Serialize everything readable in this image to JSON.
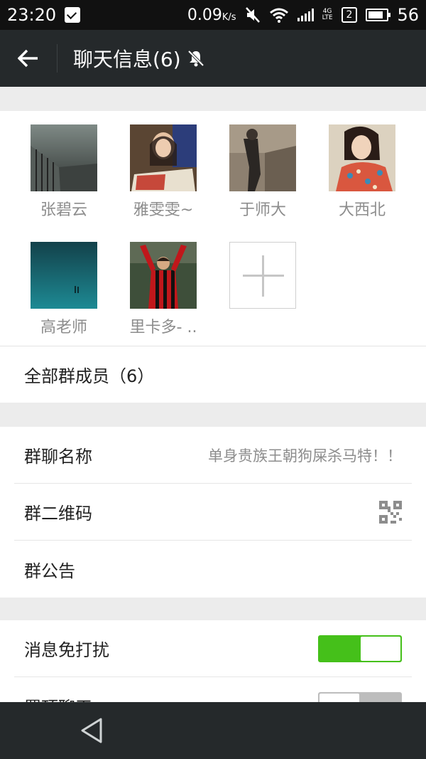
{
  "status_bar": {
    "time": "23:20",
    "speed": "0.09",
    "speed_unit": "K/s",
    "net_type": "4G",
    "net_sub": "LTE",
    "sim_slot": "2",
    "battery": "56"
  },
  "app_bar": {
    "title": "聊天信息(6)",
    "back_icon": "arrow-left-icon",
    "mute_icon": "bell-off-icon"
  },
  "members": [
    {
      "name": "张碧云",
      "avatar": "avatar-gate"
    },
    {
      "name": "雅雯雯~",
      "avatar": "avatar-girl-magazine"
    },
    {
      "name": "于师大",
      "avatar": "avatar-street"
    },
    {
      "name": "大西北",
      "avatar": "avatar-girl-floral"
    },
    {
      "name": "高老师",
      "avatar": "avatar-teal"
    },
    {
      "name": "里卡多- ..",
      "avatar": "avatar-footballer"
    }
  ],
  "add_member_icon": "plus-icon",
  "all_members_label": "全部群成员（6）",
  "settings": {
    "group_name_label": "群聊名称",
    "group_name_value": "单身贵族王朝狗屎杀马特！！",
    "qrcode_label": "群二维码",
    "qrcode_icon": "qrcode-icon",
    "notice_label": "群公告"
  },
  "toggles": {
    "mute_label": "消息免打扰",
    "mute_on": true,
    "pin_label": "置顶聊天",
    "pin_on": false
  },
  "colors": {
    "accent_green": "#45c01a",
    "app_bar_bg": "#25292b"
  }
}
